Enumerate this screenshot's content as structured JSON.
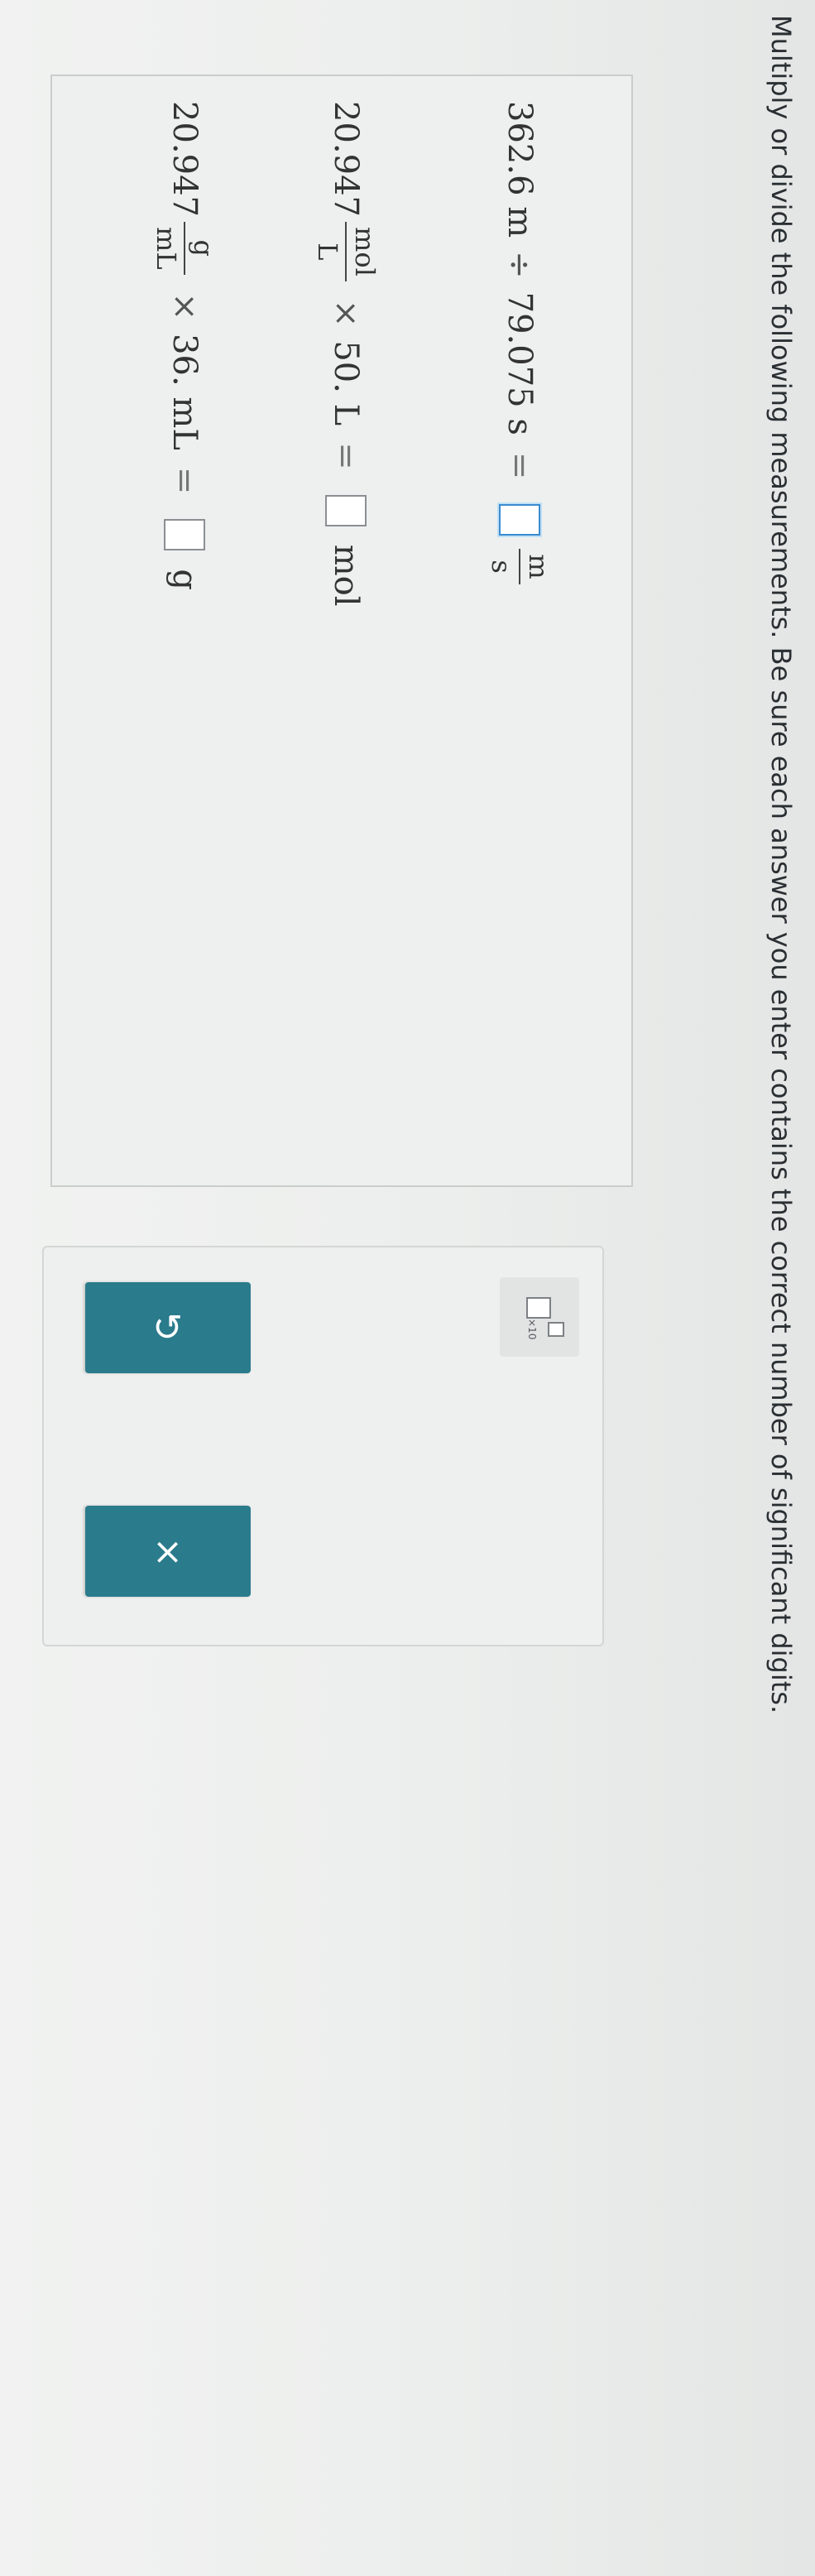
{
  "prompt": "Multiply or divide the following measurements. Be sure each answer you enter contains the correct number of significant digits.",
  "problems": [
    {
      "lhs_a": "362.6 m",
      "operator": "÷",
      "lhs_b": "79.075 s",
      "equals": "=",
      "answer_value": "",
      "answer_unit_num": "m",
      "answer_unit_den": "s"
    },
    {
      "lhs_a_value": "20.947",
      "lhs_a_unit_num": "mol",
      "lhs_a_unit_den": "L",
      "operator": "×",
      "lhs_b": "50. L",
      "equals": "=",
      "answer_value": "",
      "answer_unit": "mol"
    },
    {
      "lhs_a_value": "20.947",
      "lhs_a_unit_num": "g",
      "lhs_a_unit_den": "mL",
      "operator": "×",
      "lhs_b": "36. mL",
      "equals": "=",
      "answer_value": "",
      "answer_unit": "g"
    }
  ],
  "tools": {
    "sci_notation_label": "×10",
    "undo_symbol": "↺",
    "clear_symbol": "×"
  },
  "colors": {
    "accent": "#2a7b8c",
    "focus": "#3b8bd0",
    "background": "#eceeed"
  },
  "icons": {
    "sci_notation": "scientific-notation-icon",
    "undo": "undo-icon",
    "clear": "clear-icon"
  }
}
